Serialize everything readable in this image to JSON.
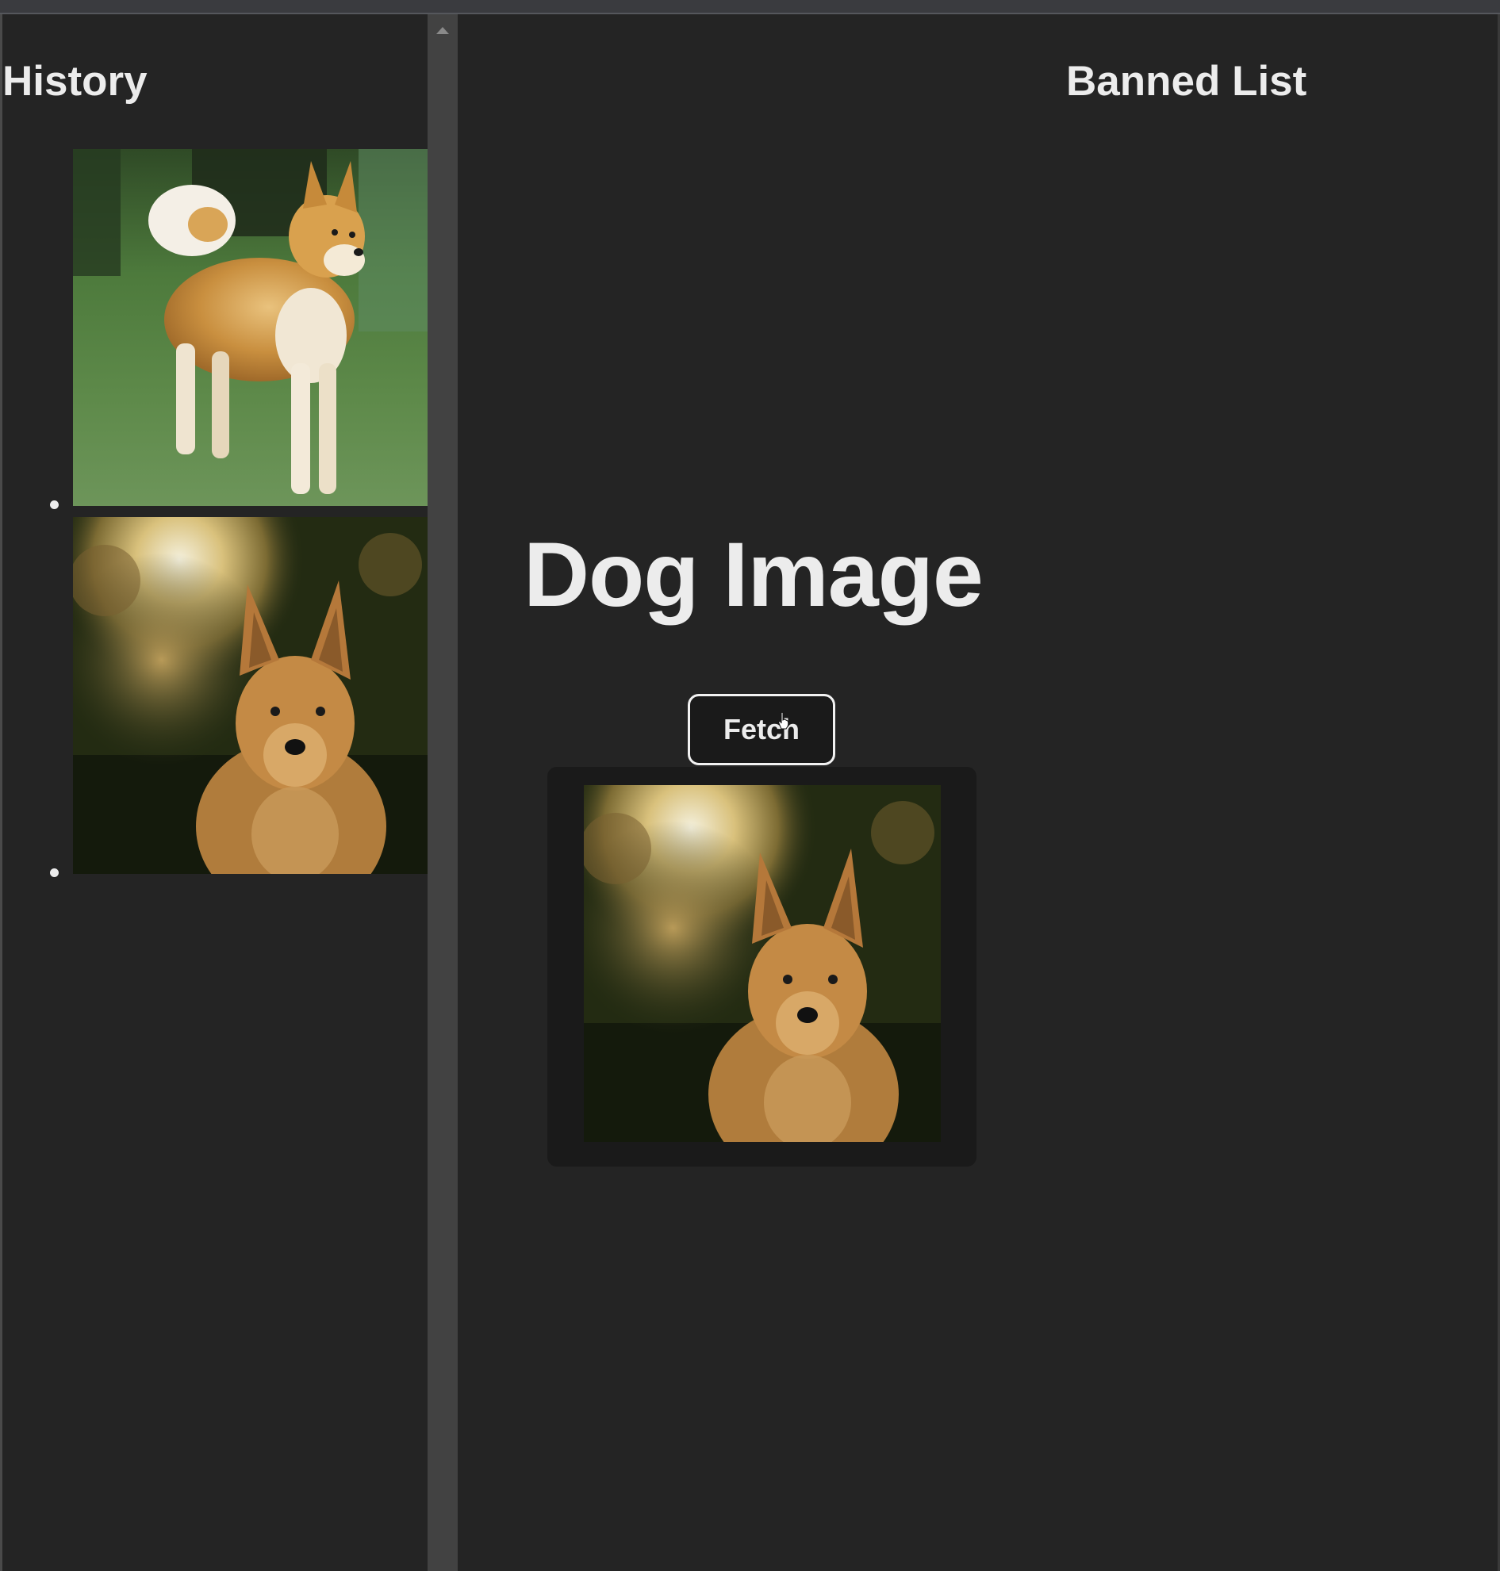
{
  "history": {
    "title": "History",
    "items": [
      {
        "image": "shiba-dog-standing-on-grass-photo"
      },
      {
        "image": "red-dog-portrait-bokeh-photo"
      }
    ]
  },
  "banned": {
    "title": "Banned List"
  },
  "main": {
    "title": "Dog Image",
    "fetch_label": "Fetch",
    "current_image": "red-dog-portrait-bokeh-photo"
  },
  "colors": {
    "background": "#242424",
    "card": "#1a1a1a",
    "text": "#ececec",
    "scrollbar": "#424242"
  }
}
